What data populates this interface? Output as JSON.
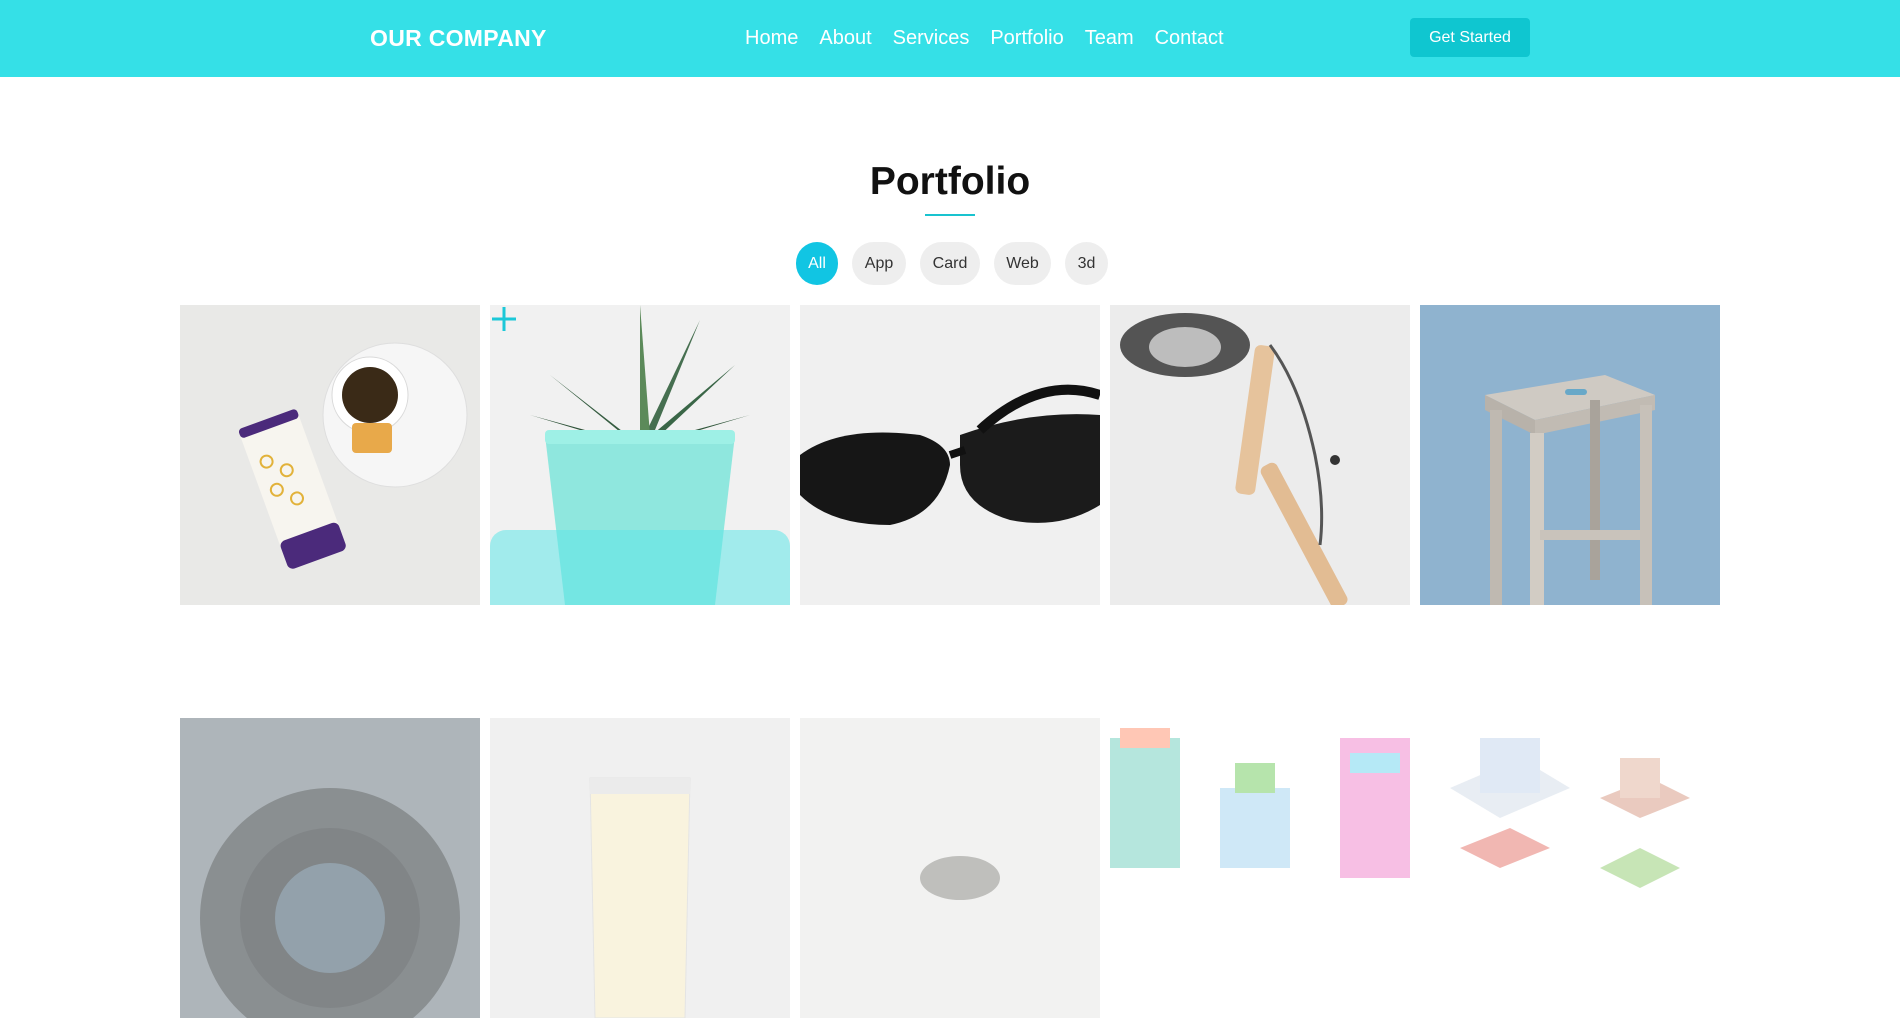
{
  "header": {
    "brand": "OUR COMPANY",
    "nav": [
      "Home",
      "About",
      "Services",
      "Portfolio",
      "Team",
      "Contact"
    ],
    "cta": "Get Started"
  },
  "portfolio": {
    "title": "Portfolio",
    "filters": [
      "All",
      "App",
      "Card",
      "Web",
      "3d"
    ],
    "active_filter": "All"
  },
  "colors": {
    "header_bg": "#35e0e7",
    "accent": "#11c5e3",
    "cta_bg": "#0fc6d0"
  },
  "icons": {
    "overlay_action": "plus-icon"
  }
}
